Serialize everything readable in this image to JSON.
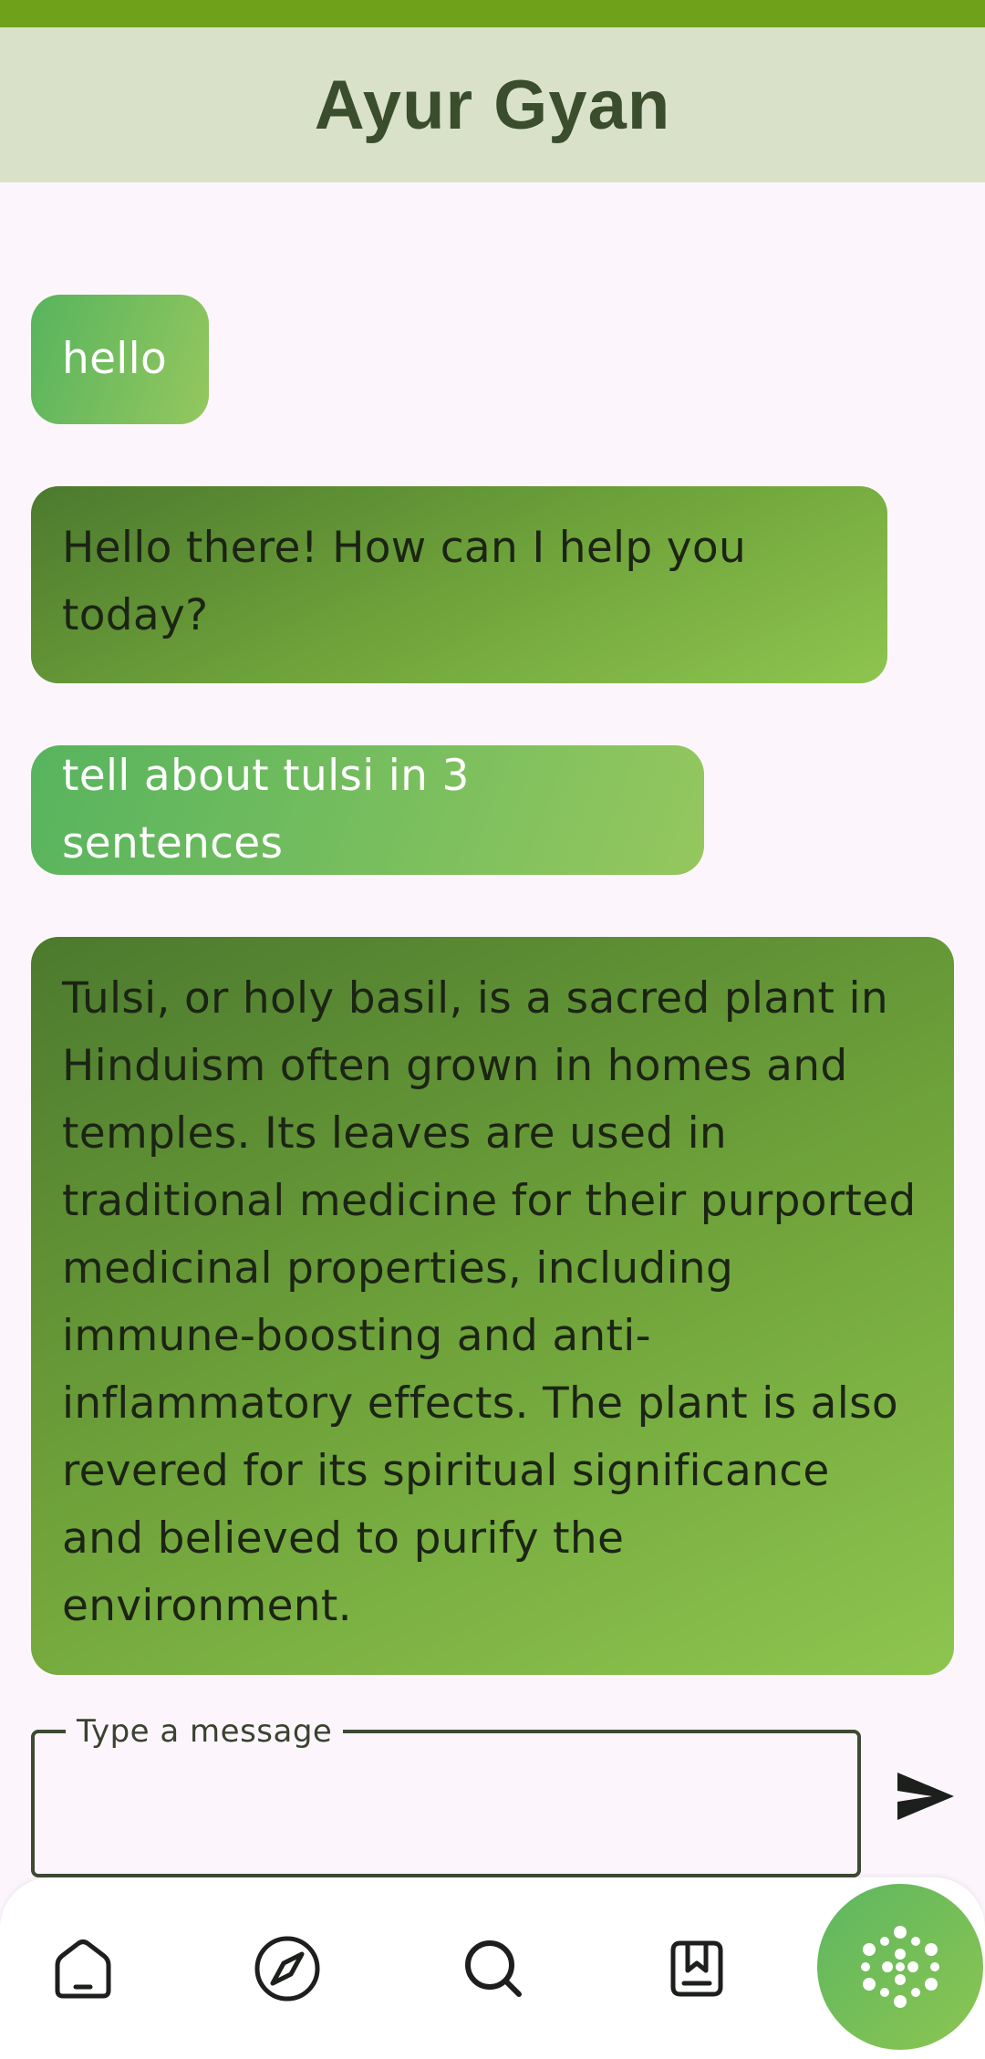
{
  "app": {
    "title": "Ayur Gyan"
  },
  "chat": {
    "messages": [
      {
        "role": "user",
        "text": "hello"
      },
      {
        "role": "assistant",
        "text": "Hello there! How can I help you today?"
      },
      {
        "role": "user",
        "text": "tell about tulsi in 3 sentences"
      },
      {
        "role": "assistant",
        "text": "Tulsi, or holy basil, is a sacred plant in Hinduism often grown in homes and temples.  Its leaves are used in traditional medicine for their purported medicinal properties, including immune-boosting and anti-inflammatory effects.  The plant is also revered for its spiritual significance and believed to purify the environment."
      }
    ]
  },
  "composer": {
    "label": "Type a message",
    "value": ""
  },
  "icons": {
    "send": "send-icon",
    "home": "home-icon",
    "explore": "compass-icon",
    "search": "search-icon",
    "saved": "bookmark-icon",
    "assistant": "ai-icon"
  },
  "colors": {
    "status_bar": "#6fa11a",
    "header_bg": "#d9e2c9",
    "title": "#3a4d2c",
    "user_bubble_start": "#57b45e",
    "user_bubble_end": "#95c75e",
    "bot_bubble_start": "#4c7a2e",
    "bot_bubble_end": "#8ec54f"
  }
}
